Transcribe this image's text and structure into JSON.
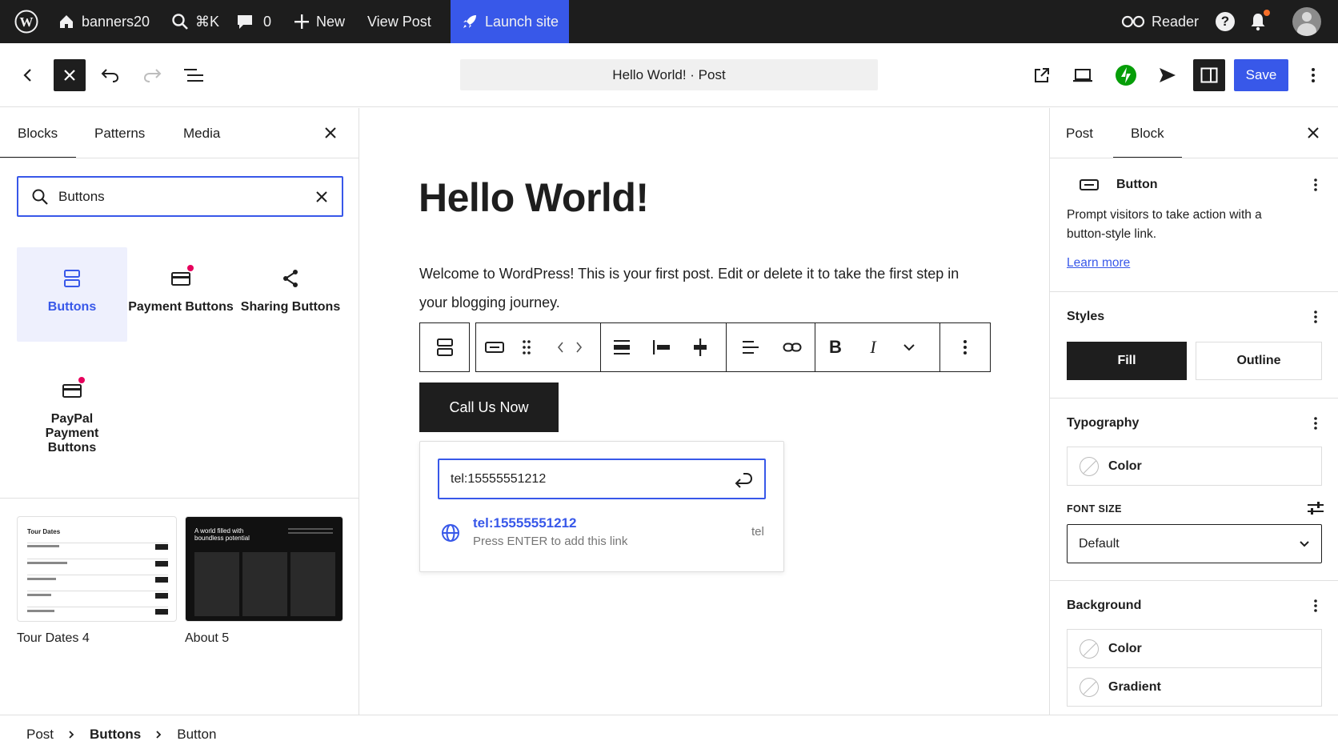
{
  "admin_bar": {
    "site_name": "banners20",
    "search_shortcut": "⌘K",
    "comments_count": "0",
    "new_label": "New",
    "view_post_label": "View Post",
    "launch_label": "Launch site",
    "reader_label": "Reader",
    "help_label": "?"
  },
  "header": {
    "doc_title": "Hello World! · Post",
    "save_label": "Save"
  },
  "inserter": {
    "tabs": [
      "Blocks",
      "Patterns",
      "Media"
    ],
    "search_value": "Buttons",
    "blocks": [
      {
        "label": "Buttons"
      },
      {
        "label": "Payment Buttons"
      },
      {
        "label": "Sharing Buttons"
      },
      {
        "label": "PayPal Payment Buttons"
      }
    ],
    "patterns": [
      {
        "label": "Tour Dates 4",
        "preview_title": "Tour Dates"
      },
      {
        "label": "About 5",
        "preview_title": "A world filled with boundless potential"
      }
    ]
  },
  "canvas": {
    "title": "Hello World!",
    "paragraph": "Welcome to WordPress! This is your first post. Edit or delete it to take the first step in your blogging journey.",
    "button_text": "Call Us Now",
    "link_value": "tel:15555551212",
    "suggestion_title": "tel:15555551212",
    "suggestion_hint": "Press ENTER to add this link",
    "suggestion_type": "tel"
  },
  "sidebar": {
    "tabs": [
      "Post",
      "Block"
    ],
    "block_name": "Button",
    "block_desc": "Prompt visitors to take action with a button-style link.",
    "learn_more": "Learn more",
    "styles_title": "Styles",
    "style_fill": "Fill",
    "style_outline": "Outline",
    "typography_title": "Typography",
    "typo_color": "Color",
    "font_size_label": "FONT SIZE",
    "font_size_value": "Default",
    "background_title": "Background",
    "bg_color": "Color",
    "bg_gradient": "Gradient"
  },
  "breadcrumb": [
    "Post",
    "Buttons",
    "Button"
  ],
  "colors": {
    "admin_bg": "#1d1d1d",
    "accent": "#3858e9",
    "dark": "#1e1e1e",
    "jetpack_green": "#069e08",
    "notification": "#e6005c"
  }
}
